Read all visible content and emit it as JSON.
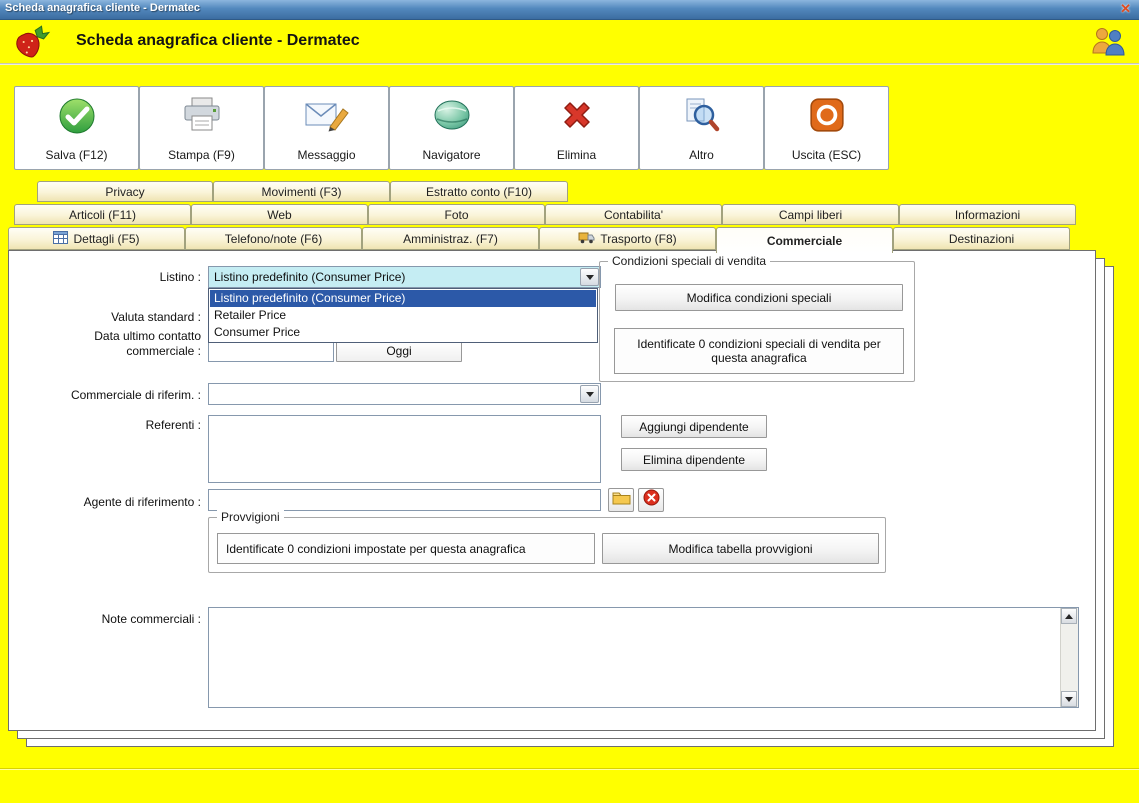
{
  "window": {
    "title": "Scheda anagrafica cliente - Dermatec",
    "close_glyph": "✕"
  },
  "header": {
    "title": "Scheda anagrafica cliente - Dermatec"
  },
  "toolbar": {
    "buttons": [
      {
        "label": "Salva (F12)",
        "icon": "save-check-icon"
      },
      {
        "label": "Stampa (F9)",
        "icon": "printer-icon"
      },
      {
        "label": "Messaggio",
        "icon": "mail-pen-icon"
      },
      {
        "label": "Navigatore",
        "icon": "globe-icon"
      },
      {
        "label": "Elimina",
        "icon": "delete-x-icon"
      },
      {
        "label": "Altro",
        "icon": "magnifier-icon"
      },
      {
        "label": "Uscita (ESC)",
        "icon": "power-icon"
      }
    ]
  },
  "tabs": {
    "row1": [
      {
        "label": "Privacy"
      },
      {
        "label": "Movimenti (F3)"
      },
      {
        "label": "Estratto conto (F10)"
      }
    ],
    "row2": [
      {
        "label": "Articoli (F11)"
      },
      {
        "label": "Web"
      },
      {
        "label": "Foto"
      },
      {
        "label": "Contabilita'"
      },
      {
        "label": "Campi liberi"
      },
      {
        "label": "Informazioni"
      }
    ],
    "row3": [
      {
        "label": "Dettagli (F5)",
        "icon": "table-icon"
      },
      {
        "label": "Telefono/note (F6)"
      },
      {
        "label": "Amministraz. (F7)"
      },
      {
        "label": "Trasporto (F8)",
        "icon": "truck-icon"
      },
      {
        "label": "Commerciale",
        "active": true
      },
      {
        "label": "Destinazioni"
      }
    ]
  },
  "form": {
    "listino": {
      "label": "Listino :",
      "value": "Listino predefinito (Consumer Price)",
      "options": [
        {
          "label": "Listino predefinito (Consumer Price)",
          "selected": true
        },
        {
          "label": "Retailer Price"
        },
        {
          "label": "Consumer Price"
        }
      ]
    },
    "valuta": {
      "label": "Valuta standard :"
    },
    "data_contatto": {
      "label_line1": "Data ultimo contatto",
      "label_line2": "commerciale :",
      "value": "",
      "oggi_button": "Oggi"
    },
    "condizioni": {
      "title": "Condizioni speciali di vendita",
      "modifica_button": "Modifica condizioni speciali",
      "info": "Identificate 0 condizioni speciali di vendita per questa anagrafica"
    },
    "commerciale_riferimento": {
      "label": "Commerciale di riferim. :",
      "value": ""
    },
    "referenti": {
      "label": "Referenti :",
      "aggiungi_button": "Aggiungi dipendente",
      "elimina_button": "Elimina dipendente"
    },
    "agente": {
      "label": "Agente di riferimento :",
      "value": ""
    },
    "provvigioni": {
      "title": "Provvigioni",
      "info": "Identificate 0 condizioni impostate per questa anagrafica",
      "modifica_button": "Modifica tabella provvigioni"
    },
    "note": {
      "label": "Note commerciali :",
      "value": ""
    }
  }
}
